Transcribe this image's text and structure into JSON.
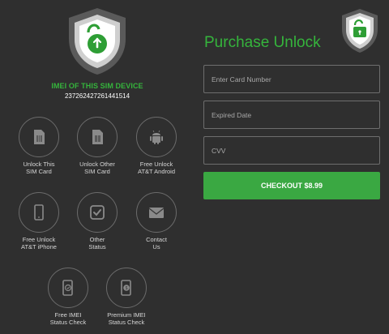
{
  "device": {
    "imei_title": "IMEI OF THIS SIM DEVICE",
    "imei_number": "237262427261441514"
  },
  "tiles": [
    {
      "label": "Unlock This\nSIM Card",
      "icon": "sim-card-icon"
    },
    {
      "label": "Unlock Other\nSIM Card",
      "icon": "sim-card-icon"
    },
    {
      "label": "Free Unlock\nAT&T Android",
      "icon": "android-icon"
    },
    {
      "label": "Free Unlock\nAT&T iPhone",
      "icon": "phone-icon"
    },
    {
      "label": "Other\nStatus",
      "icon": "checkbox-icon"
    },
    {
      "label": "Contact\nUs",
      "icon": "envelope-icon"
    },
    {
      "label": "Free IMEI\nStatus Check",
      "icon": "phone-check-icon"
    },
    {
      "label": "Premium IMEI\nStatus Check",
      "icon": "phone-premium-icon"
    }
  ],
  "purchase": {
    "title": "Purchase Unlock",
    "card_placeholder": "Enter Card Number",
    "expiry_placeholder": "Expired Date",
    "cvv_placeholder": "CVV",
    "checkout_label": "CHECKOUT $8.99"
  },
  "colors": {
    "background": "#2f2f2f",
    "accent": "#35b43c",
    "button": "#3aa842",
    "border": "#6e6e6e"
  }
}
